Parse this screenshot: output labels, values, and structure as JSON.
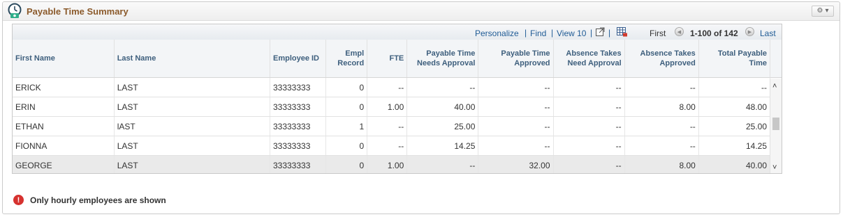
{
  "panel": {
    "title": "Payable Time Summary",
    "icon": "clock-money-icon",
    "menu_icon": "gear-icon",
    "menu_arrow": "▾",
    "gear_glyph": "⚙"
  },
  "grid_nav": {
    "personalize": "Personalize",
    "find": "Find",
    "view": "View 10",
    "first": "First",
    "range": "1-100 of 142",
    "last": "Last",
    "separator": "|",
    "prev_glyph": "◀",
    "next_glyph": "▶"
  },
  "table": {
    "headers": {
      "first_name": "First Name",
      "last_name": "Last Name",
      "employee_id": "Employee ID",
      "empl_record": "Empl Record",
      "fte": "FTE",
      "payable_needs_approval": "Payable Time Needs Approval",
      "payable_approved": "Payable Time Approved",
      "absence_needs_approval": "Absence Takes Need Approval",
      "absence_approved": "Absence Takes Approved",
      "total_payable": "Total Payable Time"
    },
    "rows": [
      {
        "first": "ERICK",
        "last": "LAST",
        "emp_id": "33333333",
        "rec": "0",
        "fte": "--",
        "pt_need": "--",
        "pt_appr": "--",
        "abs_need": "--",
        "abs_appr": "--",
        "total": "--"
      },
      {
        "first": "ERIN",
        "last": "LAST",
        "emp_id": "33333333",
        "rec": "0",
        "fte": "1.00",
        "pt_need": "40.00",
        "pt_appr": "--",
        "abs_need": "--",
        "abs_appr": "8.00",
        "total": "48.00"
      },
      {
        "first": "ETHAN",
        "last": "lAST",
        "emp_id": "33333333",
        "rec": "1",
        "fte": "--",
        "pt_need": "25.00",
        "pt_appr": "--",
        "abs_need": "--",
        "abs_appr": "--",
        "total": "25.00"
      },
      {
        "first": "FIONNA",
        "last": "LAST",
        "emp_id": "33333333",
        "rec": "0",
        "fte": "--",
        "pt_need": "14.25",
        "pt_appr": "--",
        "abs_need": "--",
        "abs_appr": "--",
        "total": "14.25"
      },
      {
        "first": "GEORGE",
        "last": "LAST",
        "emp_id": "33333333",
        "rec": "0",
        "fte": "1.00",
        "pt_need": "--",
        "pt_appr": "32.00",
        "abs_need": "--",
        "abs_appr": "8.00",
        "total": "40.00"
      }
    ],
    "scroll_up": "˄",
    "scroll_down": "˅"
  },
  "message": {
    "icon": "error-icon",
    "icon_glyph": "!",
    "text": "Only hourly employees are shown"
  },
  "colors": {
    "title": "#8b5a2b",
    "link": "#1f5b95",
    "header_text": "#3e5f7d",
    "error": "#d6322f"
  }
}
